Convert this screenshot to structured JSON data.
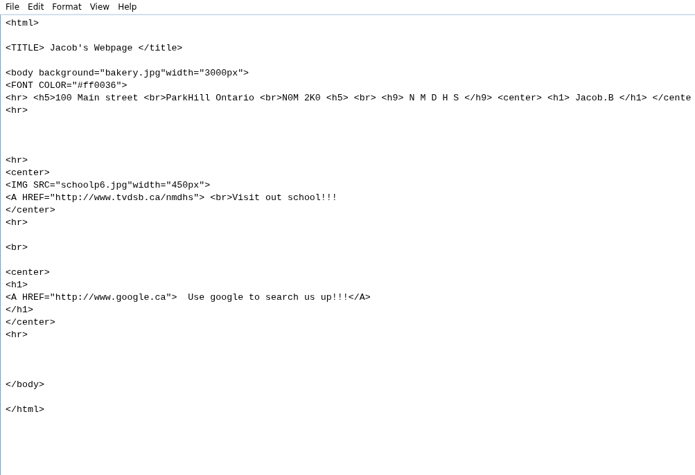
{
  "menu_bar": [
    "File",
    "Edit",
    "Format",
    "View",
    "Help"
  ],
  "editor": {
    "text": "<html>\n\n<TITLE> Jacob's Webpage </title>\n\n<body background=\"bakery.jpg\"width=\"3000px\">\n<FONT COLOR=\"#ff0036\">\n<hr> <h5>100 Main street <br>ParkHill Ontario <br>N0M 2K0 <h5> <br> <h9> N M D H S </h9> <center> <h1> Jacob.B </h1> </cente\n<hr>\n\n\n\n<hr>\n<center>\n<IMG SRC=\"schoolp6.jpg\"width=\"450px\">\n<A HREF=\"http://www.tvdsb.ca/nmdhs\"> <br>Visit out school!!!\n</center>\n<hr>\n\n<br>\n\n<center>\n<h1>\n<A HREF=\"http://www.google.ca\">  Use google to search us up!!!</A>\n</h1>\n</center>\n<hr>\n\n\n\n</body>\n\n</html>"
  }
}
